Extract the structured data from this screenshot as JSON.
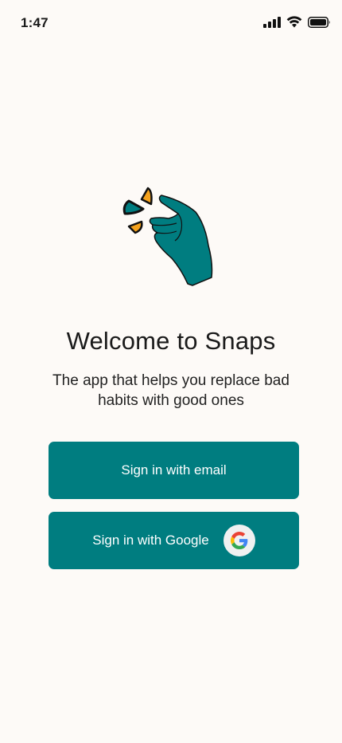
{
  "status_bar": {
    "time": "1:47",
    "icons": [
      "cellular-signal-icon",
      "wifi-icon",
      "battery-icon"
    ]
  },
  "illustration": {
    "icon": "snapping-fingers-hand-icon",
    "colors": {
      "hand": "#007d80",
      "accent_orange": "#f5a21d",
      "accent_teal": "#007d80",
      "outline": "#111111"
    }
  },
  "welcome": {
    "title": "Welcome to Snaps",
    "subtitle": "The app that helps you replace bad habits with good ones"
  },
  "actions": {
    "email_label": "Sign in with email",
    "google_label": "Sign in with Google",
    "google_icon": "google-g-icon"
  },
  "theme": {
    "background": "#fdfaf7",
    "primary": "#007d80",
    "button_text": "#ffffff"
  }
}
